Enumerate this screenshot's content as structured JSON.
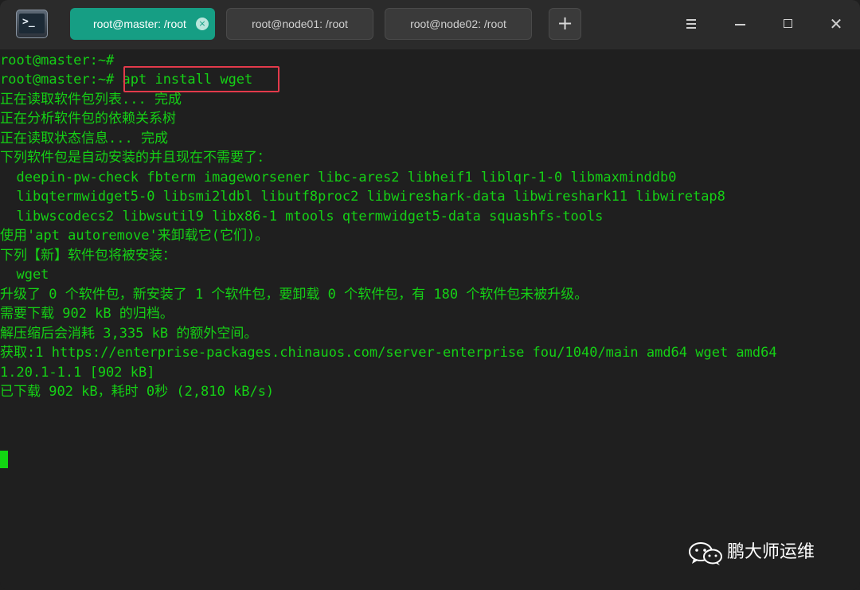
{
  "tabs": [
    {
      "label": "root@master: /root",
      "active": true
    },
    {
      "label": "root@node01: /root",
      "active": false
    },
    {
      "label": "root@node02: /root",
      "active": false
    }
  ],
  "tab_close_glyph": "×",
  "add_tab_glyph": "+",
  "window_close_glyph": "✕",
  "terminal": {
    "lines": [
      "root@master:~#",
      "root@master:~# apt install wget",
      "正在读取软件包列表... 完成",
      "正在分析软件包的依赖关系树",
      "正在读取状态信息... 完成",
      "下列软件包是自动安装的并且现在不需要了：",
      "  deepin-pw-check fbterm imageworsener libc-ares2 libheif1 liblqr-1-0 libmaxminddb0",
      "  libqtermwidget5-0 libsmi2ldbl libutf8proc2 libwireshark-data libwireshark11 libwiretap8",
      "  libwscodecs2 libwsutil9 libx86-1 mtools qtermwidget5-data squashfs-tools",
      "使用'apt autoremove'来卸载它(它们)。",
      "下列【新】软件包将被安装：",
      "  wget",
      "升级了 0 个软件包，新安装了 1 个软件包，要卸载 0 个软件包，有 180 个软件包未被升级。",
      "需要下载 902 kB 的归档。",
      "解压缩后会消耗 3,335 kB 的额外空间。",
      "获取:1 https://enterprise-packages.chinauos.com/server-enterprise fou/1040/main amd64 wget amd64",
      "1.20.1-1.1 [902 kB]",
      "已下载 902 kB，耗时 0秒 (2,810 kB/s)"
    ],
    "text_color": "#15d015",
    "background": "#1f1f1f",
    "highlight_color": "#e33a4b"
  },
  "watermark": {
    "text": "鹏大师运维",
    "icon": "wechat-icon"
  },
  "colors": {
    "titlebar": "#2b2b2b",
    "active_tab": "#169e84",
    "inactive_tab": "#3a3a3a"
  }
}
